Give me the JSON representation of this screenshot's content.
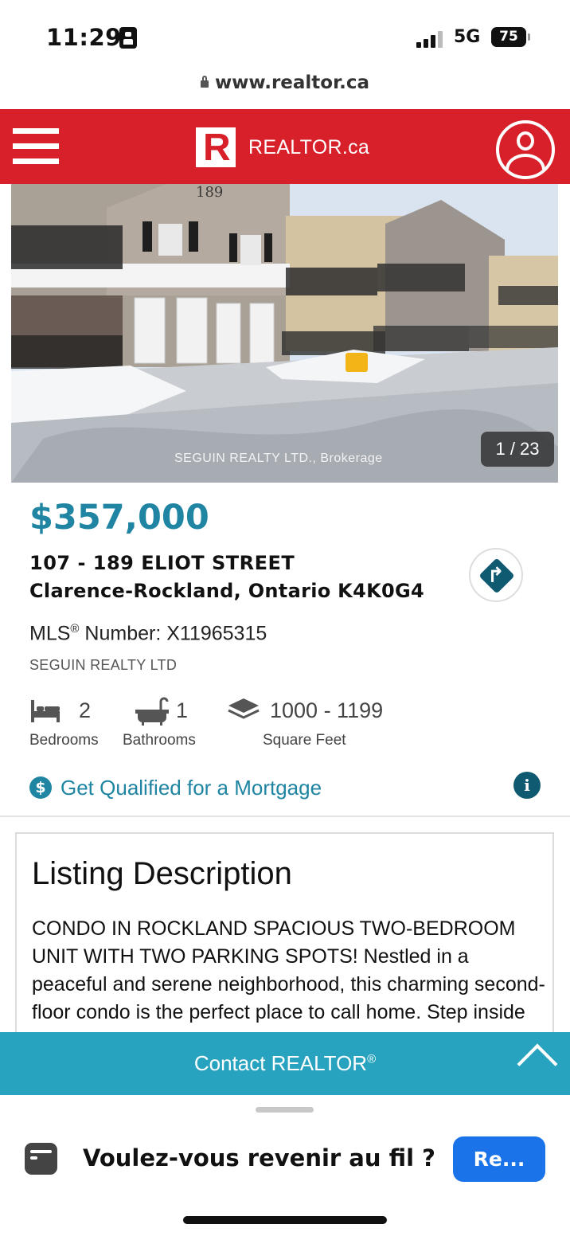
{
  "status_bar": {
    "time": "11:29",
    "network": "5G",
    "battery": "75"
  },
  "browser": {
    "url": "www.realtor.ca"
  },
  "header": {
    "logo_text": "REALTOR.ca",
    "logo_mark": "R"
  },
  "photo": {
    "counter": "1 / 23",
    "watermark": "SEGUIN REALTY LTD., Brokerage",
    "building_number": "189"
  },
  "listing": {
    "price": "$357,000",
    "address_line1": "107 - 189 ELIOT STREET",
    "address_line2": "Clarence-Rockland, Ontario K4K0G4",
    "mls_prefix": "MLS",
    "mls_registered": "®",
    "mls_suffix": " Number: X11965315",
    "brokerage": "SEGUIN REALTY LTD",
    "stats": [
      {
        "icon": "bed-icon",
        "value": "2",
        "label": "Bedrooms"
      },
      {
        "icon": "bathtub-icon",
        "value": "1",
        "label": "Bathrooms"
      },
      {
        "icon": "square-feet-icon",
        "value": "1000 - 1199",
        "label": "Square Feet"
      }
    ],
    "mortgage_link": "Get Qualified for a Mortgage"
  },
  "description": {
    "title": "Listing Description",
    "body": "CONDO IN ROCKLAND SPACIOUS TWO-BEDROOM UNIT WITH TWO PARKING SPOTS! Nestled in a peaceful and serene neighborhood, this charming second-floor condo is the perfect place to call home. Step inside to discover a spacious and sunlit interior complete with"
  },
  "contact_bar": {
    "label": "Contact REALTOR",
    "registered": "®"
  },
  "bottom_sheet": {
    "prompt": "Voulez-vous revenir au fil ?",
    "button": "Re..."
  },
  "colors": {
    "brand_red": "#d7202a",
    "accent_blue": "#1f85a3",
    "contact_bar": "#27a3bf",
    "ios_blue": "#1a73e8"
  }
}
